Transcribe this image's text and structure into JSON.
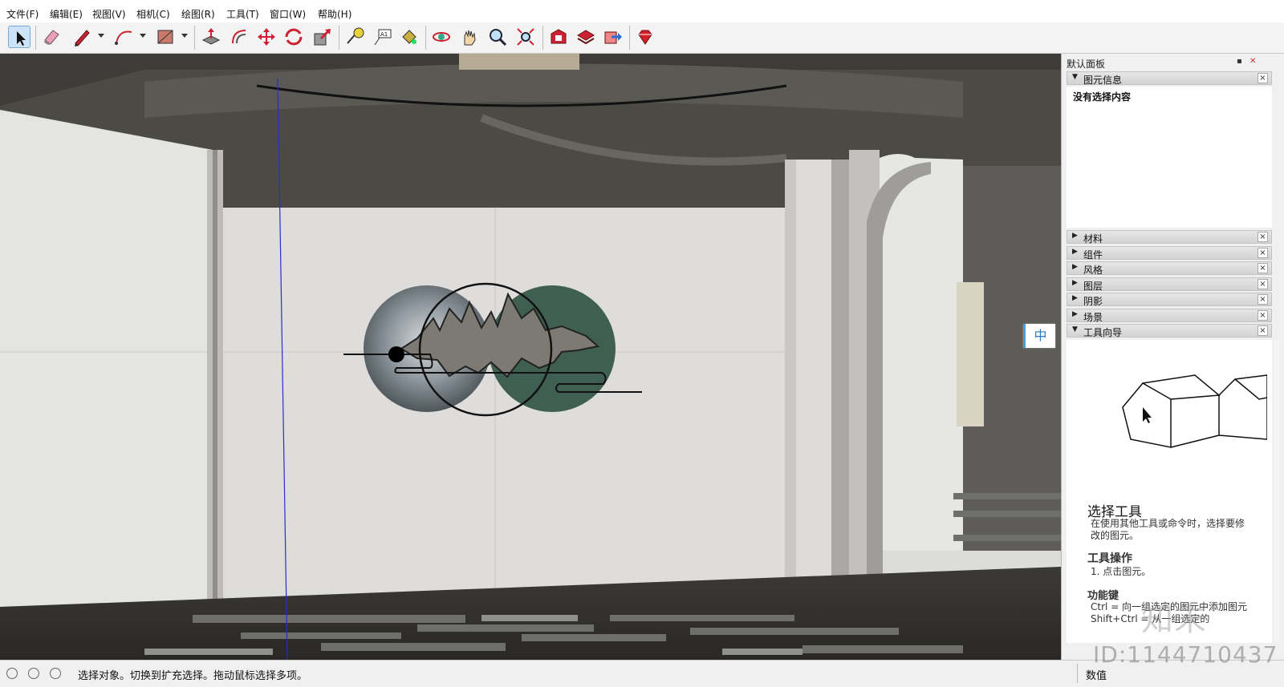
{
  "menu": {
    "items": [
      {
        "label": "文件(F)"
      },
      {
        "label": "编辑(E)"
      },
      {
        "label": "视图(V)"
      },
      {
        "label": "相机(C)"
      },
      {
        "label": "绘图(R)"
      },
      {
        "label": "工具(T)"
      },
      {
        "label": "窗口(W)"
      },
      {
        "label": "帮助(H)"
      }
    ]
  },
  "toolbar": {
    "tools": [
      {
        "icon": "select-arrow-icon"
      },
      {
        "icon": "eraser-icon"
      },
      {
        "icon": "pencil-line-icon"
      },
      {
        "icon": "arc-icon"
      },
      {
        "icon": "rectangle-icon"
      },
      {
        "icon": "push-pull-icon"
      },
      {
        "icon": "offset-icon"
      },
      {
        "icon": "move-icon"
      },
      {
        "icon": "rotate-icon"
      },
      {
        "icon": "scale-icon"
      },
      {
        "icon": "tape-measure-icon"
      },
      {
        "icon": "text-icon"
      },
      {
        "icon": "paint-bucket-icon"
      },
      {
        "icon": "orbit-icon"
      },
      {
        "icon": "pan-hand-icon"
      },
      {
        "icon": "zoom-icon"
      },
      {
        "icon": "zoom-extents-icon"
      },
      {
        "icon": "warehouse-icon"
      },
      {
        "icon": "get-models-icon"
      },
      {
        "icon": "share-model-icon"
      },
      {
        "icon": "extension-ruby-icon"
      }
    ]
  },
  "panel": {
    "title": "默认面板",
    "entity_info": {
      "label": "图元信息",
      "empty_text": "没有选择内容"
    },
    "trays": [
      {
        "label": "材料"
      },
      {
        "label": "组件"
      },
      {
        "label": "风格"
      },
      {
        "label": "图层"
      },
      {
        "label": "阴影"
      },
      {
        "label": "场景"
      }
    ],
    "instructor": {
      "label": "工具向导",
      "title": "选择工具",
      "desc": "在使用其他工具或命令时，选择要修改的图元。",
      "ops_heading": "工具操作",
      "op1": "1. 点击图元。",
      "func_heading": "功能键",
      "func1": "Ctrl = 向一组选定的图元中添加图元",
      "func2": "Shift+Ctrl = 从一组选定的"
    }
  },
  "ime": {
    "label": "中"
  },
  "status": {
    "text": "选择对象。切换到扩充选择。拖动鼠标选择多项。",
    "measure_label": "数值"
  },
  "watermark": {
    "id_text": "ID:1144710437",
    "logo_text": "知末"
  },
  "colors": {
    "accent": "#4a9bd6",
    "teal_circle": "#3f5f52",
    "wall": "#dcdcd8",
    "ceiling": "#4b4a45"
  }
}
